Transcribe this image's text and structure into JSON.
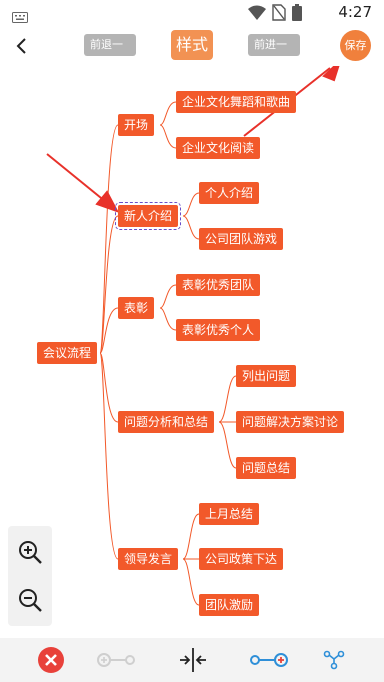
{
  "status_bar": {
    "time": "4:27",
    "icons": [
      "keyboard-icon",
      "wifi-icon",
      "no-sim-icon",
      "battery-icon"
    ]
  },
  "toolbar": {
    "undo_label": "前退一步",
    "style_label": "样式",
    "redo_label": "前进一步",
    "save_label": "保存"
  },
  "mindmap": {
    "root": "会议流程",
    "branches": [
      {
        "label": "开场",
        "children": [
          "企业文化舞蹈和歌曲",
          "企业文化阅读"
        ]
      },
      {
        "label": "新人介绍",
        "selected": true,
        "children": [
          "个人介绍",
          "公司团队游戏"
        ]
      },
      {
        "label": "表彰",
        "children": [
          "表彰优秀团队",
          "表彰优秀个人"
        ]
      },
      {
        "label": "问题分析和总结",
        "children": [
          "列出问题",
          "问题解决方案讨论",
          "问题总结"
        ]
      },
      {
        "label": "领导发言",
        "children": [
          "上月总结",
          "公司政策下达",
          "团队激励"
        ]
      }
    ]
  },
  "zoom": {
    "in_icon": "zoom-in-icon",
    "out_icon": "zoom-out-icon"
  },
  "bottom_bar": {
    "icons": [
      "delete-icon",
      "add-sibling-icon",
      "collapse-icon",
      "add-child-icon",
      "layout-icon"
    ]
  },
  "colors": {
    "node": "#f2592a",
    "accent": "#f0803c",
    "line": "#f2592a",
    "arrow": "#e8312a",
    "delete": "#e8413a",
    "blue": "#2e8fd8"
  }
}
